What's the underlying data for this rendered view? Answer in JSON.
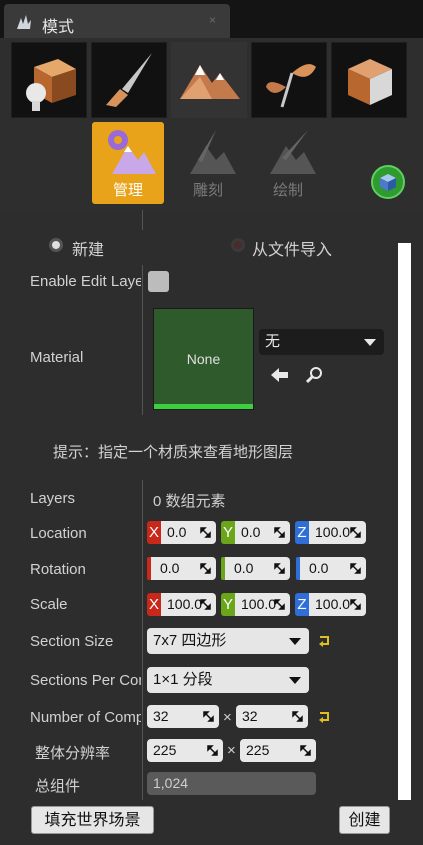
{
  "window": {
    "title": "模式",
    "close": "×"
  },
  "modes": {
    "items": [
      {
        "icon": "place-mode-icon"
      },
      {
        "icon": "paint-mode-icon"
      },
      {
        "icon": "landscape-mode-icon"
      },
      {
        "icon": "foliage-mode-icon"
      },
      {
        "icon": "geometry-mode-icon"
      }
    ],
    "active_index": 2
  },
  "subtools": {
    "manage": "管理",
    "sculpt": "雕刻",
    "paint": "绘制"
  },
  "new_landscape": {
    "create_new": "新建",
    "import_file": "从文件导入"
  },
  "enable_edit_layers": {
    "label": "Enable Edit Layers",
    "checked": false
  },
  "material": {
    "label": "Material",
    "thumb": "None",
    "value": "无"
  },
  "hint": "提示：指定一个材质来查看地形图层",
  "layers": {
    "label": "Layers",
    "value": "0 数组元素"
  },
  "location": {
    "label": "Location",
    "x": "0.0",
    "y": "0.0",
    "z": "100.0",
    "x_axis": "X",
    "y_axis": "Y",
    "z_axis": "Z"
  },
  "rotation": {
    "label": "Rotation",
    "x": "0.0",
    "y": "0.0",
    "z": "0.0"
  },
  "scale": {
    "label": "Scale",
    "x": "100.0",
    "y": "100.0",
    "z": "100.0",
    "x_axis": "X",
    "y_axis": "Y",
    "z_axis": "Z"
  },
  "section_size": {
    "label": "Section Size",
    "value": "7x7 四边形"
  },
  "sections_per_component": {
    "label": "Sections Per Component",
    "value": "1×1 分段"
  },
  "number_of_components": {
    "label": "Number of Components",
    "x": "32",
    "y": "32",
    "sep": "×"
  },
  "overall_resolution": {
    "label": "整体分辨率",
    "x": "225",
    "y": "225",
    "sep": "×"
  },
  "total_components": {
    "label": "总组件",
    "value": "1,024"
  },
  "buttons": {
    "fill_world": "填充世界场景",
    "create": "创建"
  },
  "colors": {
    "accent": "#e8a31a",
    "panel": "#2d2d2d",
    "green": "#2f9a2f"
  }
}
